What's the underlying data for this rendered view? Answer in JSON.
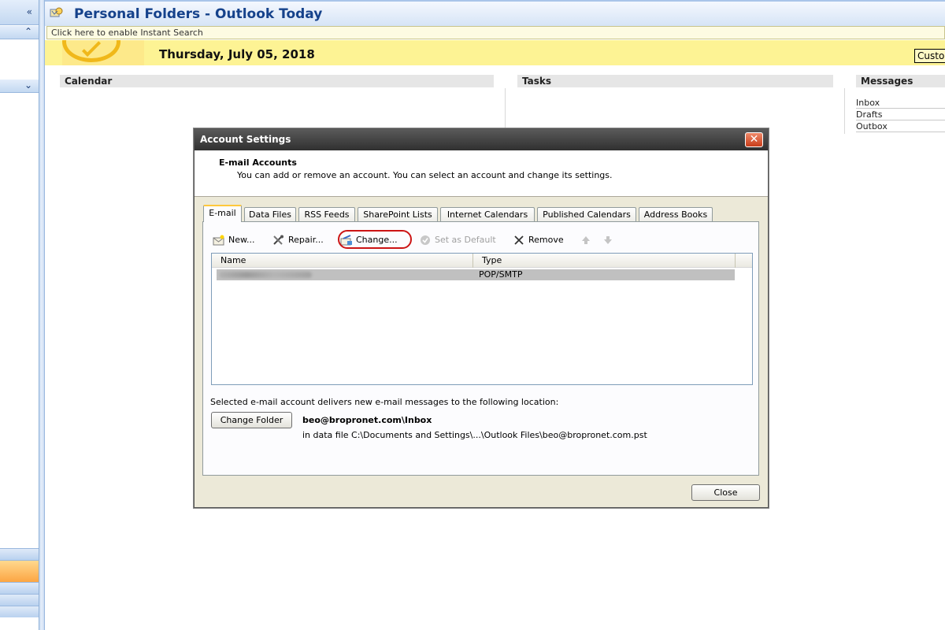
{
  "window": {
    "title": "Personal Folders - Outlook Today",
    "search_hint": "Click here to enable Instant Search",
    "nav_collapse_glyph": "«",
    "nav_up_glyph": "⌃",
    "nav_down_glyph": "⌄"
  },
  "today": {
    "date": "Thursday, July 05, 2018",
    "customize_label": "Custo",
    "columns": {
      "calendar": "Calendar",
      "tasks": "Tasks",
      "messages": "Messages"
    },
    "messages": [
      "Inbox",
      "Drafts",
      "Outbox"
    ]
  },
  "dialog": {
    "title": "Account Settings",
    "close_glyph": "✕",
    "heading": "E-mail Accounts",
    "description": "You can add or remove an account. You can select an account and change its settings.",
    "tabs": [
      {
        "label": "E-mail",
        "active": true
      },
      {
        "label": "Data Files"
      },
      {
        "label": "RSS Feeds"
      },
      {
        "label": "SharePoint Lists"
      },
      {
        "label": "Internet Calendars"
      },
      {
        "label": "Published Calendars"
      },
      {
        "label": "Address Books"
      }
    ],
    "toolbar": {
      "new_label": "New...",
      "repair_label": "Repair...",
      "change_label": "Change...",
      "set_default_label": "Set as Default",
      "remove_label": "Remove"
    },
    "list": {
      "headers": {
        "name": "Name",
        "type": "Type"
      },
      "rows": [
        {
          "name": "",
          "type": "POP/SMTP"
        }
      ]
    },
    "deliver_text": "Selected e-mail account delivers new e-mail messages to the following location:",
    "change_folder_label": "Change Folder",
    "folder_path": "beo@bropronet.com\\Inbox",
    "file_path": "in data file C:\\Documents and Settings\\...\\Outlook Files\\beo@bropronet.com.pst",
    "close_label": "Close"
  },
  "colors": {
    "accent": "#15428b",
    "highlight_ring": "#cc1414",
    "day_bar": "#fdf394"
  }
}
